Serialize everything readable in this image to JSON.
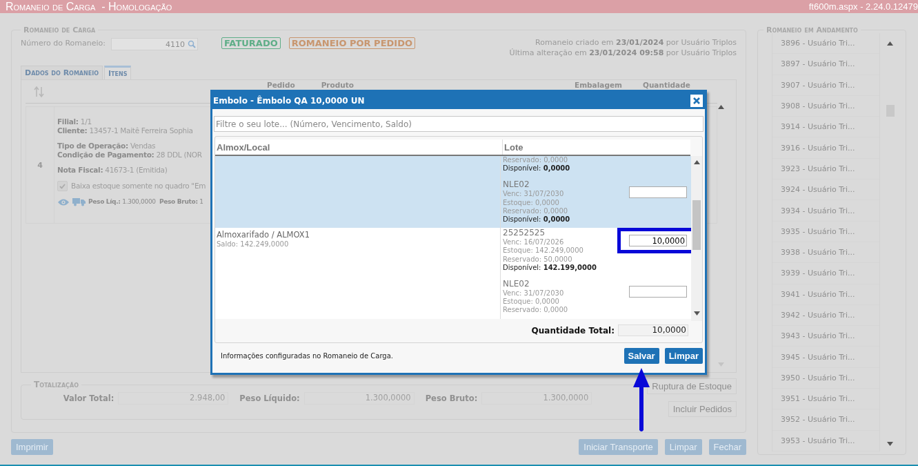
{
  "header": {
    "title": "Romaneio de Carga  - Homologação",
    "version": "ft600m.aspx - 2.24.0.12479"
  },
  "romaneio": {
    "legend": "Romaneio de Carga",
    "number_label": "Número do Romaneio:",
    "number": "4110",
    "badges": [
      {
        "text": "FATURADO",
        "color": "#5fae88"
      },
      {
        "text": "ROMANEIO POR PEDIDO",
        "color": "#c8966f"
      }
    ],
    "info": [
      "Romaneio criado em **23/01/2024** por Usuário Triplos",
      "Última alteração em **23/01/2024 09:58** por Usuário Triplos"
    ]
  },
  "tabs": [
    {
      "label": "Dados do Romaneio",
      "selected": false
    },
    {
      "label": "Itens",
      "selected": true
    }
  ],
  "items_table": {
    "columns": [
      {
        "label": "Pedido"
      },
      {
        "label": "Produto"
      },
      {
        "label": "Embalagem"
      },
      {
        "label": "Quantidade"
      }
    ],
    "rows": [
      {
        "number": "4",
        "groups": [
          [
            "**Filial:** 1/1",
            "**Cliente:** 13457-1 Maitê Ferreira Sophia"
          ],
          [
            "**Tipo de Operação:** Vendas",
            "**Condição de Pagamento:** 28 DDL (NOR"
          ],
          [
            "**Nota Fiscal:** 41673-1 (Emitida)"
          ]
        ],
        "checkbox": {
          "label": "Baixa estoque somente no quadro \"Em",
          "checked": true
        },
        "weights": "**Peso Líq.:** 1.300,0000  **Peso Bruto:** 1"
      }
    ]
  },
  "totalizacao": {
    "legend": "Totalização",
    "fields": [
      {
        "label": "Valor Total:",
        "value": "2.948,00"
      },
      {
        "label": "Peso Líquido:",
        "value": "1.300,0000"
      },
      {
        "label": "Peso Bruto:",
        "value": "1.300,0000"
      }
    ]
  },
  "side_buttons": [
    "Ruptura de Estoque",
    "Incluir Pedidos"
  ],
  "footer_buttons": {
    "left": [
      "Imprimir"
    ],
    "right": [
      "Iniciar Transporte",
      "Limpar",
      "Fechar"
    ]
  },
  "in_progress": {
    "legend": "Romaneio em Andamento",
    "items": [
      "3896 - Usuário Tri...",
      "3897 - Usuário Tri...",
      "3907 - Usuário Tri...",
      "3908 - Usuário Tri...",
      "3914 - Usuário Tri...",
      "3916 - Usuário Tri...",
      "3923 - Usuário Tri...",
      "3924 - Usuário Tri...",
      "3934 - Usuário Tri...",
      "3935 - Usuário Tri...",
      "3938 - Usuário Tri...",
      "3939 - Usuário Tri...",
      "3941 - Usuário Tri...",
      "3942 - Usuário Tri...",
      "3943 - Usuário Tri...",
      "3945 - Usuário Tri...",
      "3950 - Usuário Tri...",
      "3951 - Usuário Tri...",
      "3952 - Usuário Tri...",
      "3953 - Usuário Tri..."
    ]
  },
  "modal": {
    "title": "Embolo - Êmbolo QA 10,0000 UN",
    "filter_placeholder": "Filtre o seu lote... (Número, Vencimento, Saldo)",
    "columns": [
      "Almox/Local",
      "Lote"
    ],
    "groups": [
      {
        "selected": true,
        "lots": [
          {
            "lines": [
              {
                "kind": "detail",
                "text": "Reservado: 0,0000"
              },
              {
                "kind": "available",
                "text": "Disponível: **0,0000**"
              }
            ],
            "input": false
          },
          {
            "name": "NLE02",
            "lines": [
              {
                "kind": "detail",
                "text": "Venc: 31/07/2030"
              },
              {
                "kind": "detail",
                "text": "Estoque: 0,0000"
              },
              {
                "kind": "detail",
                "text": "Reservado: 0,0000"
              },
              {
                "kind": "available",
                "text": "Disponível: **0,0000**"
              }
            ],
            "input": true,
            "highlighted": false
          }
        ]
      },
      {
        "selected": false,
        "location": "Almoxarifado / ALMOX1",
        "saldo": "Saldo: 142.249,0000",
        "lots": [
          {
            "name": "25252525",
            "lines": [
              {
                "kind": "detail",
                "text": "Venc: 16/07/2026"
              },
              {
                "kind": "detail",
                "text": "Estoque: 142.249,0000"
              },
              {
                "kind": "detail",
                "text": "Reservado: 50,0000"
              },
              {
                "kind": "available",
                "text": "Disponível: **142.199,0000**"
              }
            ],
            "input": true,
            "value": "10,0000",
            "highlighted": true
          },
          {
            "name": "NLE02",
            "lines": [
              {
                "kind": "detail",
                "text": "Venc: 31/07/2030"
              },
              {
                "kind": "detail",
                "text": "Estoque: 0,0000"
              },
              {
                "kind": "detail",
                "text": "Reservado: 0,0000"
              }
            ],
            "input": true,
            "highlighted": false
          }
        ]
      }
    ],
    "total_label": "Quantidade Total:",
    "total": "10,0000",
    "info": "Informações configuradas no Romaneio de Carga.",
    "buttons": [
      {
        "label": "Salvar",
        "highlighted": true
      },
      {
        "label": "Limpar",
        "highlighted": false
      }
    ]
  }
}
